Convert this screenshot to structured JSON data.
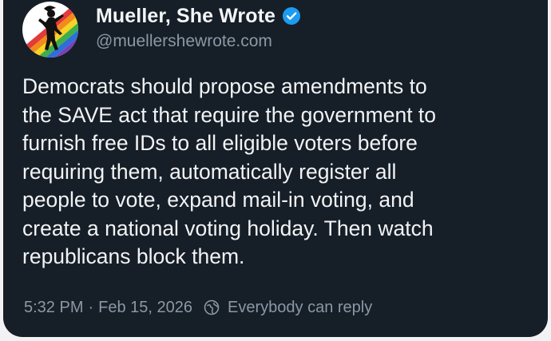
{
  "author": {
    "display_name": "Mueller, She Wrote",
    "handle": "@muellershewrote.com",
    "verified": true,
    "avatar_icon": "rainbow-silhouette-avatar"
  },
  "post": {
    "text_lines": [
      "Democrats should propose amendments to",
      "the SAVE act that require the government to",
      "furnish free IDs to all eligible voters before",
      "requiring them, automatically register all",
      "people to vote, expand mail-in voting, and",
      "create a national voting holiday. Then watch",
      "republicans block them."
    ]
  },
  "meta": {
    "time": "5:32 PM",
    "separator": "·",
    "date": "Feb 15, 2026",
    "reply_setting": "Everybody can reply",
    "reply_icon": "globe-icon"
  },
  "colors": {
    "background": "#161e27",
    "text": "#f1f3f5",
    "muted": "#8b98a5",
    "verified": "#1d9bf0"
  }
}
